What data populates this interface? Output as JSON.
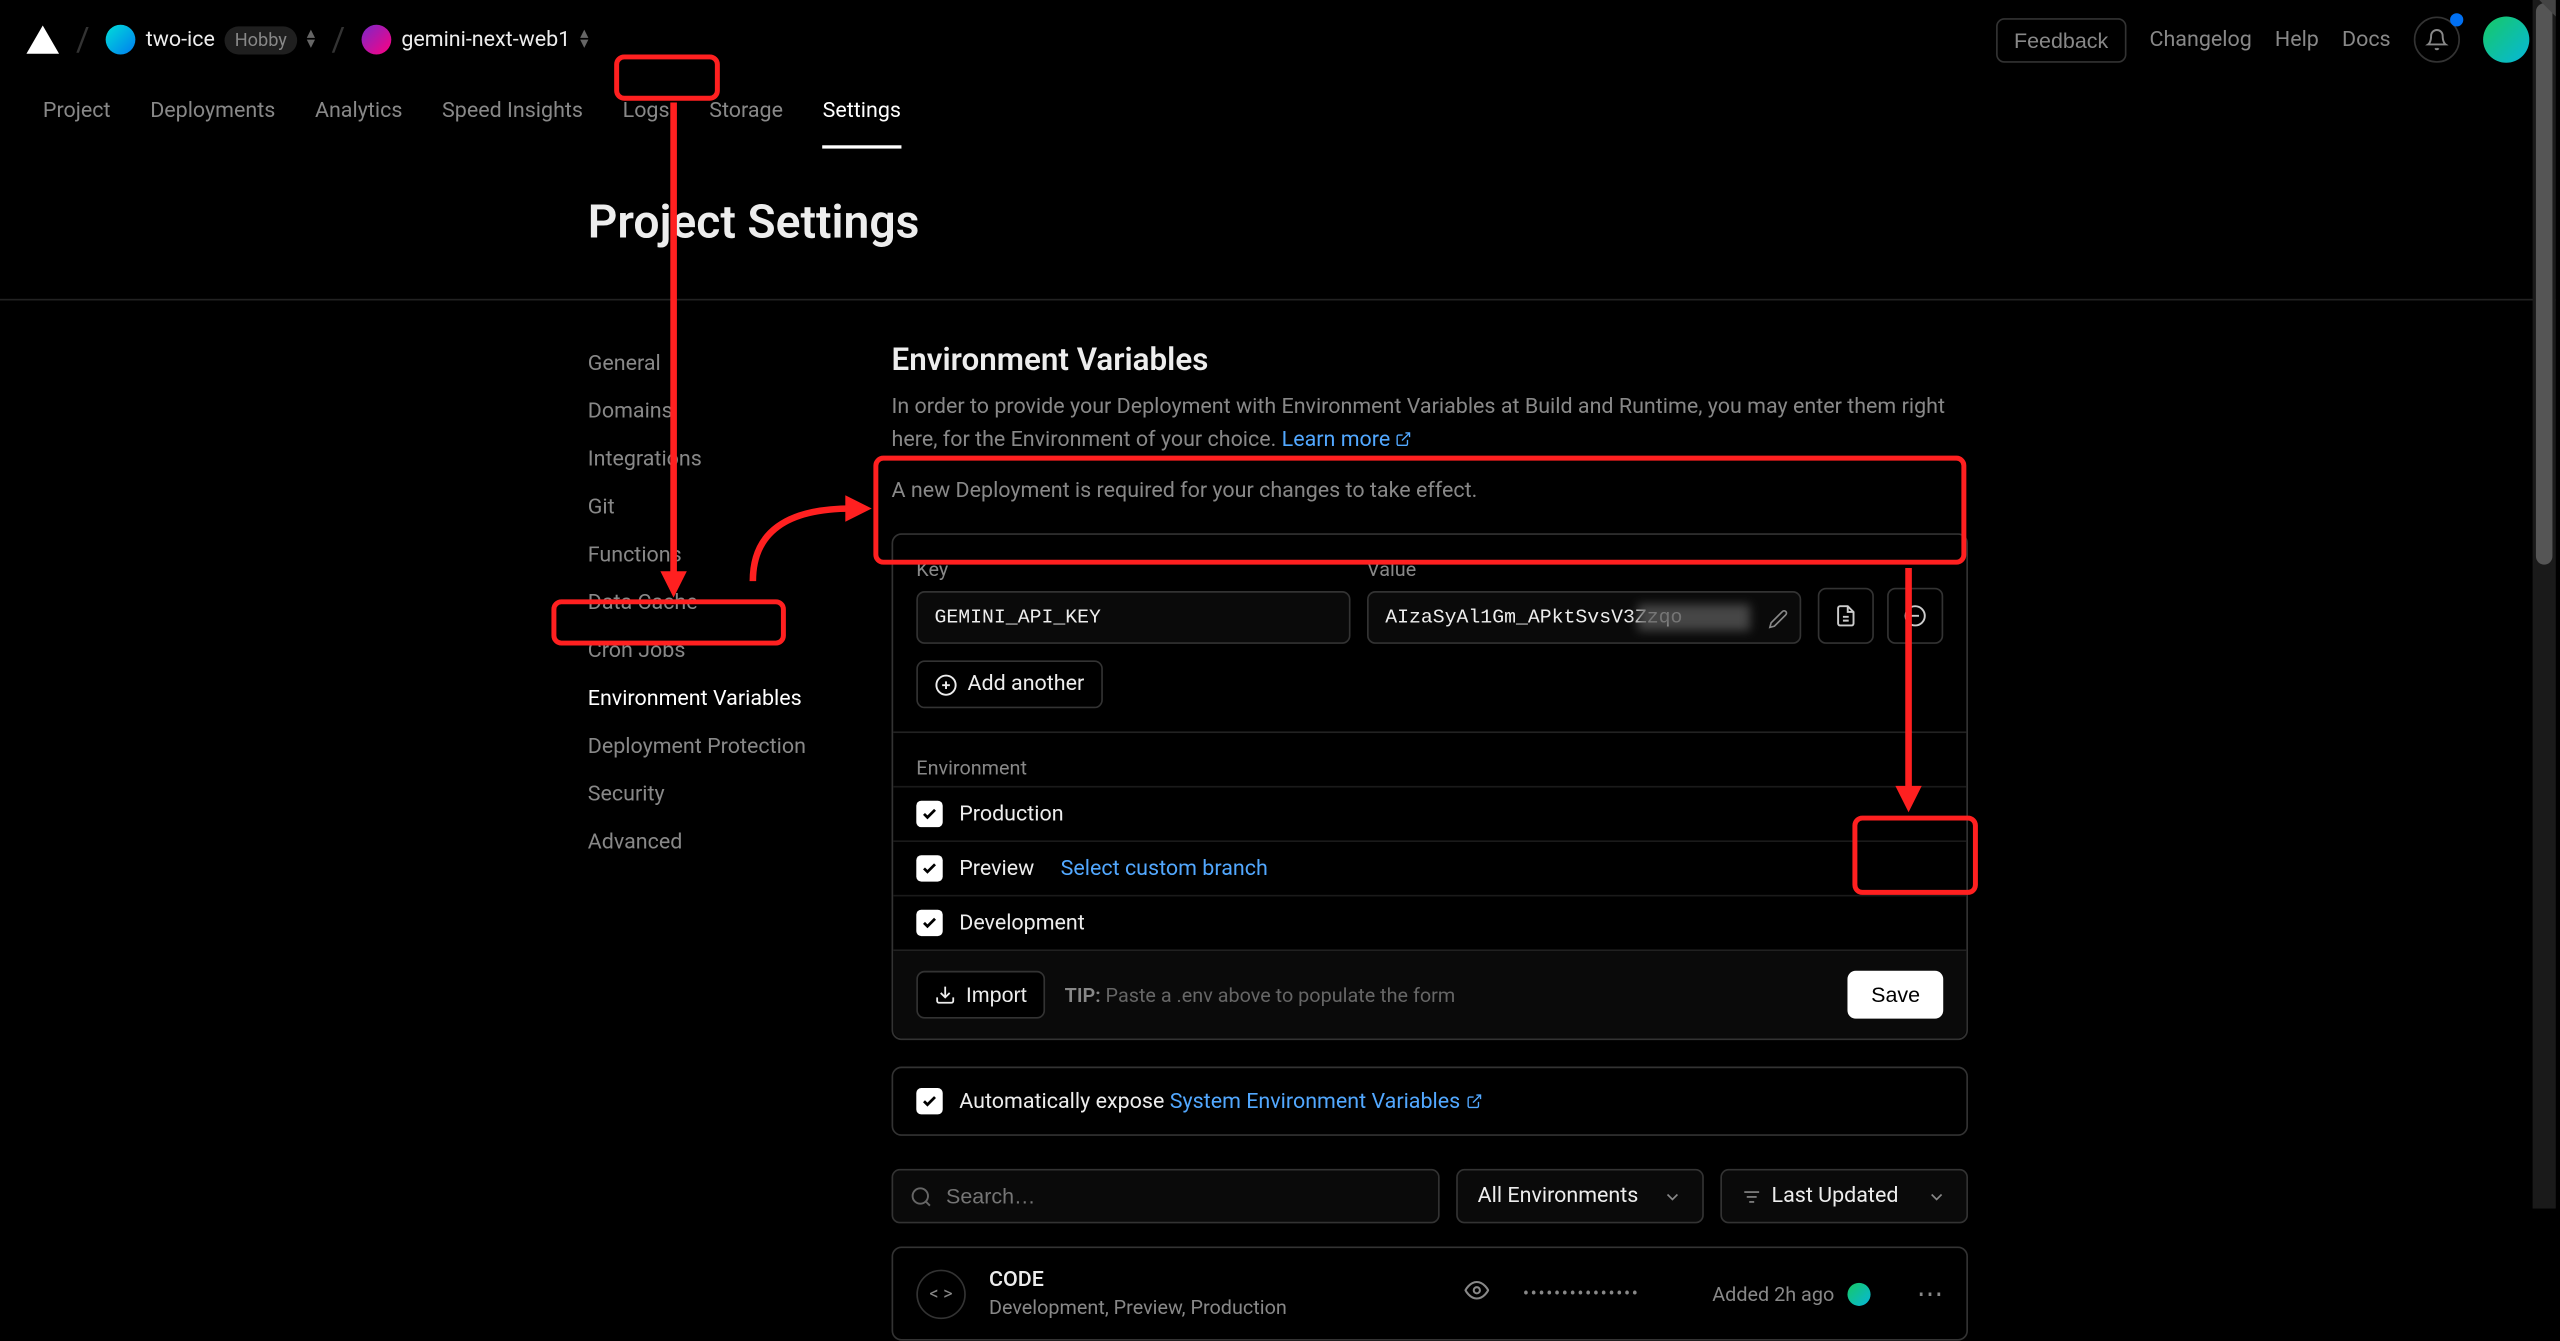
{
  "header": {
    "team_name": "two-ice",
    "team_badge": "Hobby",
    "project_name": "gemini-next-web1",
    "right": {
      "feedback": "Feedback",
      "changelog": "Changelog",
      "help": "Help",
      "docs": "Docs"
    }
  },
  "tabs": [
    {
      "label": "Project",
      "active": false
    },
    {
      "label": "Deployments",
      "active": false
    },
    {
      "label": "Analytics",
      "active": false
    },
    {
      "label": "Speed Insights",
      "active": false
    },
    {
      "label": "Logs",
      "active": false
    },
    {
      "label": "Storage",
      "active": false
    },
    {
      "label": "Settings",
      "active": true
    }
  ],
  "page_title": "Project Settings",
  "sidebar": {
    "items": [
      {
        "label": "General"
      },
      {
        "label": "Domains"
      },
      {
        "label": "Integrations"
      },
      {
        "label": "Git"
      },
      {
        "label": "Functions"
      },
      {
        "label": "Data Cache"
      },
      {
        "label": "Cron Jobs"
      },
      {
        "label": "Environment Variables"
      },
      {
        "label": "Deployment Protection"
      },
      {
        "label": "Security"
      },
      {
        "label": "Advanced"
      }
    ],
    "active_index": 7
  },
  "envvars": {
    "heading": "Environment Variables",
    "desc_1": "In order to provide your Deployment with Environment Variables at Build and Runtime, you may enter them right here, for the Environment of your choice.",
    "learn_more": "Learn more",
    "note": "A new Deployment is required for your changes to take effect.",
    "key_label": "Key",
    "value_label": "Value",
    "key_input": "GEMINI_API_KEY",
    "value_input": "AIzaSyAl1Gm_APktSvsV3Zzqo",
    "add_another": "Add another",
    "env_section_label": "Environment",
    "checks": {
      "production": "Production",
      "preview": "Preview",
      "preview_link": "Select custom branch",
      "development": "Development"
    },
    "footer": {
      "import": "Import",
      "tip_label": "TIP:",
      "tip_text": "Paste a .env above to populate the form",
      "save": "Save"
    }
  },
  "expose": {
    "prefix": "Automatically expose",
    "link": "System Environment Variables"
  },
  "filters": {
    "search_placeholder": "Search…",
    "env_dropdown": "All Environments",
    "sort_dropdown": "Last Updated"
  },
  "existing": {
    "name": "CODE",
    "envs": "Development, Preview, Production",
    "masked": "•••••••••••••••",
    "added": "Added 2h ago"
  }
}
